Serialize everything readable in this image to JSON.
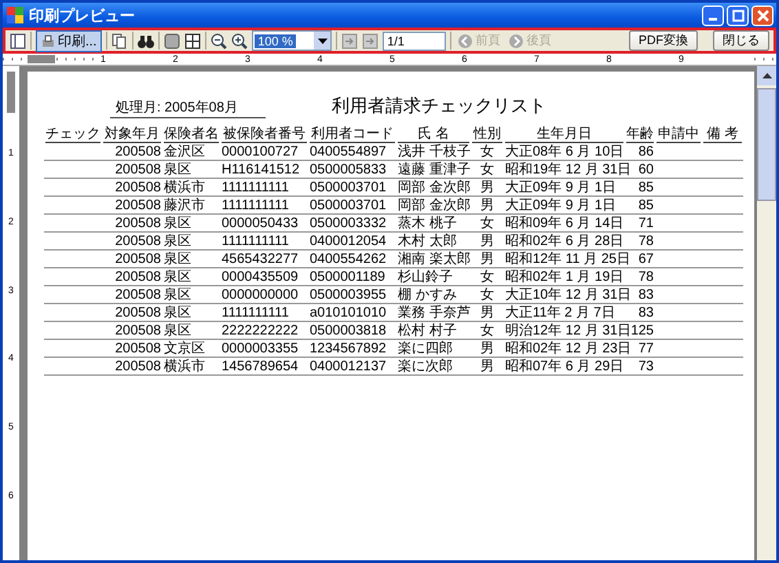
{
  "window": {
    "title": "印刷プレビュー"
  },
  "toolbar": {
    "print_button": {
      "label": "印刷...",
      "selected": true
    },
    "zoom": {
      "value": "100 %"
    },
    "page": {
      "value": "1/1"
    },
    "nav": [
      {
        "label": "前頁",
        "disabled": true
      },
      {
        "label": "後頁",
        "disabled": true
      }
    ],
    "pdf_button": {
      "label": "PDF変換"
    },
    "close_button": {
      "label": "閉じる"
    }
  },
  "ruler": {
    "horizontal": [
      "1",
      "2",
      "3",
      "4",
      "5",
      "6",
      "7",
      "8",
      "9"
    ],
    "vertical": [
      "1",
      "2",
      "3",
      "4",
      "5",
      "6"
    ]
  },
  "report": {
    "processing_month": "処理月: 2005年08月",
    "title": "利用者請求チェックリスト",
    "columns": [
      "チェック",
      "対象年月",
      "保険者名",
      "被保険者番号",
      "利用者コード",
      "氏 名",
      "性別",
      "生年月日",
      "年齢",
      "申請中",
      "備 考"
    ],
    "rows": [
      [
        "",
        "200508",
        "金沢区",
        "0000100727",
        "0400554897",
        "浅井 千枝子",
        "女",
        "大正08年 6 月 10日",
        "86"
      ],
      [
        "",
        "200508",
        "泉区",
        "H116141512",
        "0500005833",
        "遠藤 重津子",
        "女",
        "昭和19年 12 月 31日",
        "60"
      ],
      [
        "",
        "200508",
        "横浜市",
        "1111111111",
        "0500003701",
        "岡部 金次郎",
        "男",
        "大正09年 9 月 1日",
        "85"
      ],
      [
        "",
        "200508",
        "藤沢市",
        "1111111111",
        "0500003701",
        "岡部 金次郎",
        "男",
        "大正09年 9 月 1日",
        "85"
      ],
      [
        "",
        "200508",
        "泉区",
        "0000050433",
        "0500003332",
        "蒸木 桃子",
        "女",
        "昭和09年 6 月 14日",
        "71"
      ],
      [
        "",
        "200508",
        "泉区",
        "1111111111",
        "0400012054",
        "木村 太郎",
        "男",
        "昭和02年 6 月 28日",
        "78"
      ],
      [
        "",
        "200508",
        "泉区",
        "4565432277",
        "0400554262",
        "湘南 楽太郎",
        "男",
        "昭和12年 11 月 25日",
        "67"
      ],
      [
        "",
        "200508",
        "泉区",
        "0000435509",
        "0500001189",
        "杉山鈴子",
        "女",
        "昭和02年 1 月 19日",
        "78"
      ],
      [
        "",
        "200508",
        "泉区",
        "0000000000",
        "0500003955",
        "棚 かすみ",
        "女",
        "大正10年 12 月 31日",
        "83"
      ],
      [
        "",
        "200508",
        "泉区",
        "1111111111",
        "a010101010",
        "業務 手奈芦",
        "男",
        "大正11年 2 月 7日",
        "83"
      ],
      [
        "",
        "200508",
        "泉区",
        "2222222222",
        "0500003818",
        "松村 村子",
        "女",
        "明治12年 12 月 31日",
        "125"
      ],
      [
        "",
        "200508",
        "文京区",
        "0000003355",
        "1234567892",
        "楽に四郎",
        "男",
        "昭和02年 12 月 23日",
        "77"
      ],
      [
        "",
        "200508",
        "横浜市",
        "1456789654",
        "0400012137",
        "楽に次郎",
        "男",
        "昭和07年 6 月 29日",
        "73"
      ]
    ]
  }
}
